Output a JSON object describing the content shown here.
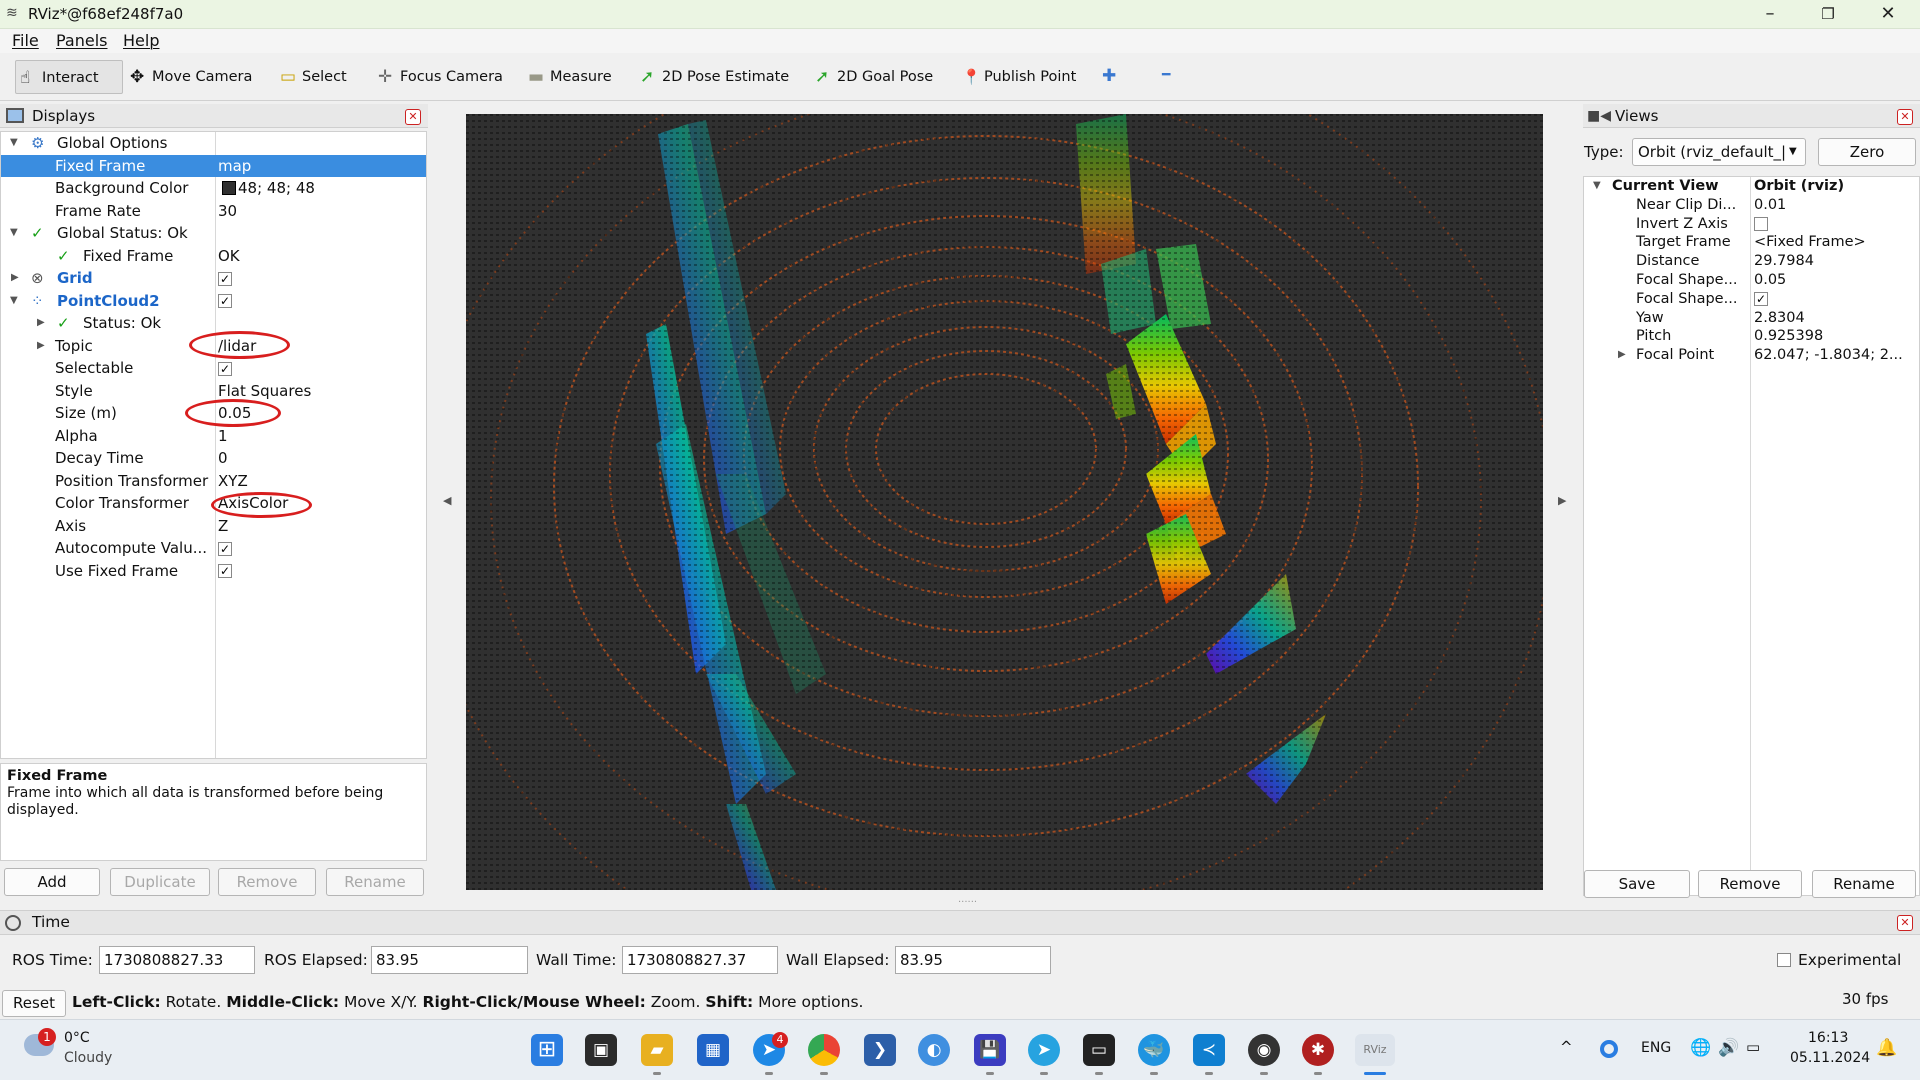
{
  "window": {
    "title": "RViz*@f68ef248f7a0",
    "minimize": "–",
    "restore": "❐",
    "close": "✕"
  },
  "menu": [
    "File",
    "Panels",
    "Help"
  ],
  "toolbar": [
    {
      "label": "Interact",
      "icon": "hand-pointer-icon",
      "glyph": "☝"
    },
    {
      "label": "Move Camera",
      "icon": "move-camera-icon",
      "glyph": "✥"
    },
    {
      "label": "Select",
      "icon": "select-icon",
      "glyph": "▭"
    },
    {
      "label": "Focus Camera",
      "icon": "focus-camera-icon",
      "glyph": "✛"
    },
    {
      "label": "Measure",
      "icon": "ruler-icon",
      "glyph": "▬"
    },
    {
      "label": "2D Pose Estimate",
      "icon": "pose-estimate-icon",
      "glyph": "➚"
    },
    {
      "label": "2D Goal Pose",
      "icon": "goal-pose-icon",
      "glyph": "➚"
    },
    {
      "label": "Publish Point",
      "icon": "map-pin-icon",
      "glyph": "📍"
    }
  ],
  "toolbar_extra": {
    "add": "✚",
    "remove": "━"
  },
  "displays": {
    "title": "Displays",
    "rows": [
      {
        "label": "Global Options",
        "value": ""
      },
      {
        "label": "Fixed Frame",
        "value": "map"
      },
      {
        "label": "Background Color",
        "value": "48; 48; 48"
      },
      {
        "label": "Frame Rate",
        "value": "30"
      },
      {
        "label": "Global Status: Ok",
        "value": ""
      },
      {
        "label": "Fixed Frame",
        "value": "OK"
      },
      {
        "label": "Grid",
        "value": "✓"
      },
      {
        "label": "PointCloud2",
        "value": "✓"
      },
      {
        "label": "Status: Ok",
        "value": ""
      },
      {
        "label": "Topic",
        "value": "/lidar"
      },
      {
        "label": "Selectable",
        "value": "✓"
      },
      {
        "label": "Style",
        "value": "Flat Squares"
      },
      {
        "label": "Size (m)",
        "value": "0.05"
      },
      {
        "label": "Alpha",
        "value": "1"
      },
      {
        "label": "Decay Time",
        "value": "0"
      },
      {
        "label": "Position Transformer",
        "value": "XYZ"
      },
      {
        "label": "Color Transformer",
        "value": "AxisColor"
      },
      {
        "label": "Axis",
        "value": "Z"
      },
      {
        "label": "Autocompute Valu...",
        "value": "✓"
      },
      {
        "label": "Use Fixed Frame",
        "value": "✓"
      }
    ],
    "desc_title": "Fixed Frame",
    "desc_text": "Frame into which all data is transformed before being displayed.",
    "buttons": [
      "Add",
      "Duplicate",
      "Remove",
      "Rename"
    ]
  },
  "views": {
    "title": "Views",
    "type_label": "Type:",
    "type_value": "Orbit (rviz_default_|",
    "zero": "Zero",
    "rows": [
      {
        "label": "Current View",
        "value": "Orbit (rviz)"
      },
      {
        "label": "Near Clip Di...",
        "value": "0.01"
      },
      {
        "label": "Invert Z Axis",
        "value": ""
      },
      {
        "label": "Target Frame",
        "value": "<Fixed Frame>"
      },
      {
        "label": "Distance",
        "value": "29.7984"
      },
      {
        "label": "Focal Shape...",
        "value": "0.05"
      },
      {
        "label": "Focal Shape...",
        "value": "✓"
      },
      {
        "label": "Yaw",
        "value": "2.8304"
      },
      {
        "label": "Pitch",
        "value": "0.925398"
      },
      {
        "label": "Focal Point",
        "value": "62.047; -1.8034; 2..."
      }
    ],
    "buttons": [
      "Save",
      "Remove",
      "Rename"
    ]
  },
  "time": {
    "title": "Time",
    "ros_time_label": "ROS Time:",
    "ros_time": "1730808827.33",
    "ros_elapsed_label": "ROS Elapsed:",
    "ros_elapsed": "83.95",
    "wall_time_label": "Wall Time:",
    "wall_time": "1730808827.37",
    "wall_elapsed_label": "Wall Elapsed:",
    "wall_elapsed": "83.95",
    "experimental": "Experimental"
  },
  "status": {
    "reset": "Reset",
    "b1": "Left-Click:",
    "t1": " Rotate. ",
    "b2": "Middle-Click:",
    "t2": " Move X/Y. ",
    "b3": "Right-Click/Mouse Wheel:",
    "t3": " Zoom. ",
    "b4": "Shift:",
    "t4": " More options.",
    "fps": "30 fps"
  },
  "taskbar": {
    "weather_badge": "1",
    "temp": "0°C",
    "cond": "Cloudy",
    "lang": "ENG",
    "time": "16:13",
    "date": "05.11.2024",
    "badge4": "4",
    "rviz_label": "RViz",
    "chevron": "^"
  },
  "colors": {
    "selection": "#3a8de0",
    "viewport_bg": "#303030",
    "annotation": "#d81e1e",
    "status_ok": "#18a018",
    "link_blue": "#1c66c8"
  }
}
